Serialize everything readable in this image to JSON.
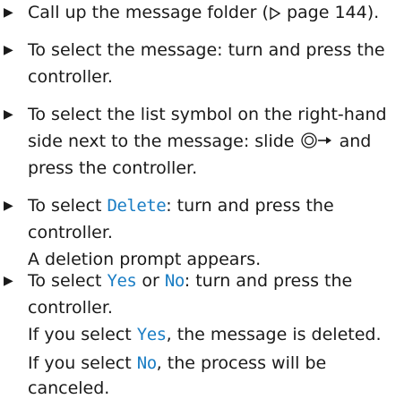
{
  "steps": [
    {
      "line1_pre": "Call up the message folder (",
      "page_ref_icon": "triangle-right-outline-icon",
      "line1_post": " page 144)."
    },
    {
      "line1": "To select the message: turn and press the",
      "line2": "controller."
    },
    {
      "line1": "To select the list symbol on the right-hand",
      "line2": "side next to the message: slide ",
      "controller_icon": "controller-slide-right-icon",
      "line3": "and",
      "line3b": "press the controller."
    },
    {
      "line1_pre": "To select ",
      "keyword": "Delete",
      "line1_post": ": turn and press the",
      "line2": "controller.",
      "result": "A deletion prompt appears."
    },
    {
      "line1_pre": "To select ",
      "keyword_yes": "Yes",
      "line1_mid": " or ",
      "keyword_no": "No",
      "line1_post": ": turn and press the",
      "line2": "controller.",
      "result_yes_pre": "If you select ",
      "result_yes_kw": "Yes",
      "result_yes_post": ", the message is deleted.",
      "result_no_pre": "If you select ",
      "result_no_kw": "No",
      "result_no_post": ", the process will be",
      "result_no_line2": "canceled."
    }
  ],
  "colors": {
    "text": "#1a1a1a",
    "keyword": "#1a7dc4"
  }
}
